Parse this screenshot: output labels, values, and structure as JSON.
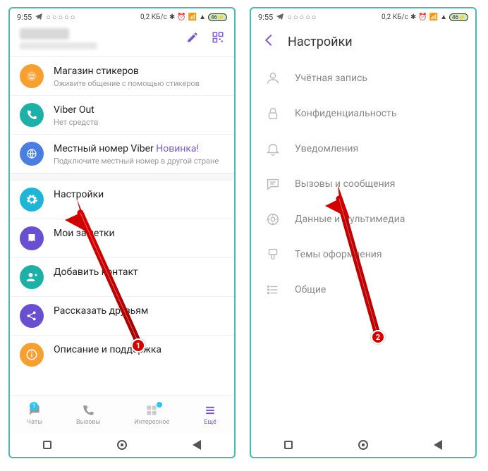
{
  "status": {
    "time": "9:55",
    "net": "0,2 КБ/с",
    "batt": "46"
  },
  "phone1": {
    "items": {
      "stickers": {
        "title": "Магазин стикеров",
        "sub": "Оживите общение с помощью стикеров"
      },
      "viberout": {
        "title": "Viber Out",
        "sub": "Нет средств"
      },
      "localnum": {
        "title_a": "Местный номер Viber ",
        "title_b": "Новинка!",
        "sub": "Подключите местный номер в другой стране"
      },
      "settings": {
        "title": "Настройки"
      },
      "notes": {
        "title": "Мои заметки"
      },
      "addcontact": {
        "title": "Добавить контакт"
      },
      "share": {
        "title": "Рассказать друзьям"
      },
      "about": {
        "title": "Описание и поддержка"
      }
    },
    "nav": {
      "chats": "Чаты",
      "calls": "Вызовы",
      "interesting": "Интересное",
      "more": "Ещё",
      "badge": "1"
    },
    "badge_num": "1"
  },
  "phone2": {
    "title": "Настройки",
    "rows": {
      "account": "Учётная запись",
      "privacy": "Конфиденциальность",
      "notifications": "Уведомления",
      "calls_msgs": "Вызовы и сообщения",
      "media": "Данные и мультимедиа",
      "themes": "Темы оформления",
      "general": "Общие"
    },
    "badge_num": "2"
  }
}
